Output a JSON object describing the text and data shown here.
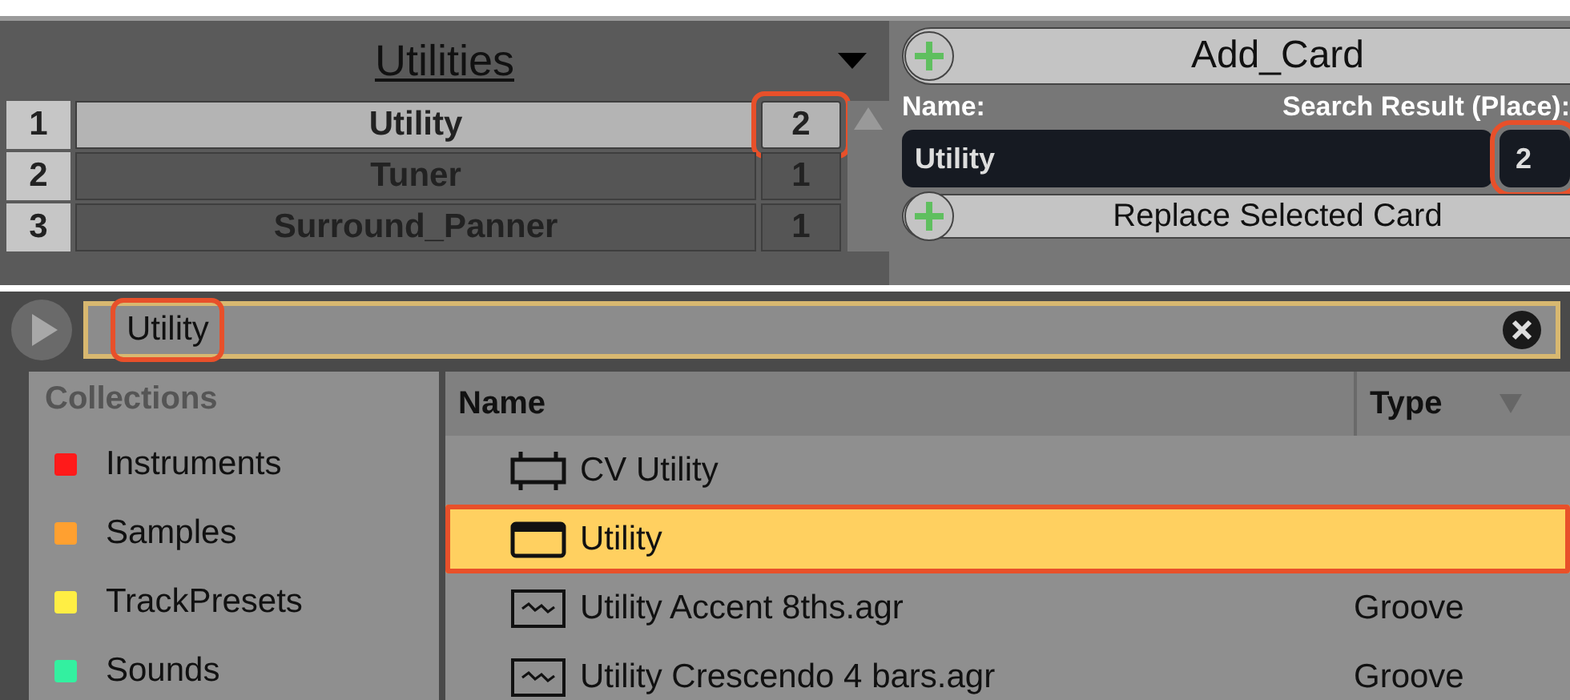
{
  "device_list": {
    "title": "Utilities",
    "rows": [
      {
        "index": "1",
        "name": "Utility",
        "count": "2",
        "selected": true,
        "highlighted": true
      },
      {
        "index": "2",
        "name": "Tuner",
        "count": "1",
        "selected": false,
        "highlighted": false
      },
      {
        "index": "3",
        "name": "Surround_Panner",
        "count": "1",
        "selected": false,
        "highlighted": false
      }
    ]
  },
  "card_panel": {
    "add_button": "Add_Card",
    "name_label": "Name:",
    "result_label": "Search Result (Place):",
    "name_value": "Utility",
    "result_value": "2",
    "result_highlighted": true,
    "replace_button": "Replace Selected Card"
  },
  "browser": {
    "search": {
      "value": "Utility",
      "highlighted": true
    },
    "collections": {
      "title": "Collections",
      "items": [
        {
          "label": "Instruments",
          "color": "#ff1a1a"
        },
        {
          "label": "Samples",
          "color": "#ffa030"
        },
        {
          "label": "TrackPresets",
          "color": "#ffee44"
        },
        {
          "label": "Sounds",
          "color": "#33f0a0"
        }
      ]
    },
    "columns": [
      "Name",
      "Type"
    ],
    "files": [
      {
        "kind": "device",
        "name": "CV Utility",
        "selected": false,
        "highlighted": false
      },
      {
        "kind": "rack",
        "name": "Utility",
        "selected": true,
        "highlighted": true
      },
      {
        "kind": "groove",
        "name": "Utility Accent 8ths.agr",
        "type": "Groove",
        "selected": false,
        "highlighted": false
      },
      {
        "kind": "groove",
        "name": "Utility Crescendo 4 bars.agr",
        "type": "Groove",
        "selected": false,
        "highlighted": false
      }
    ]
  }
}
